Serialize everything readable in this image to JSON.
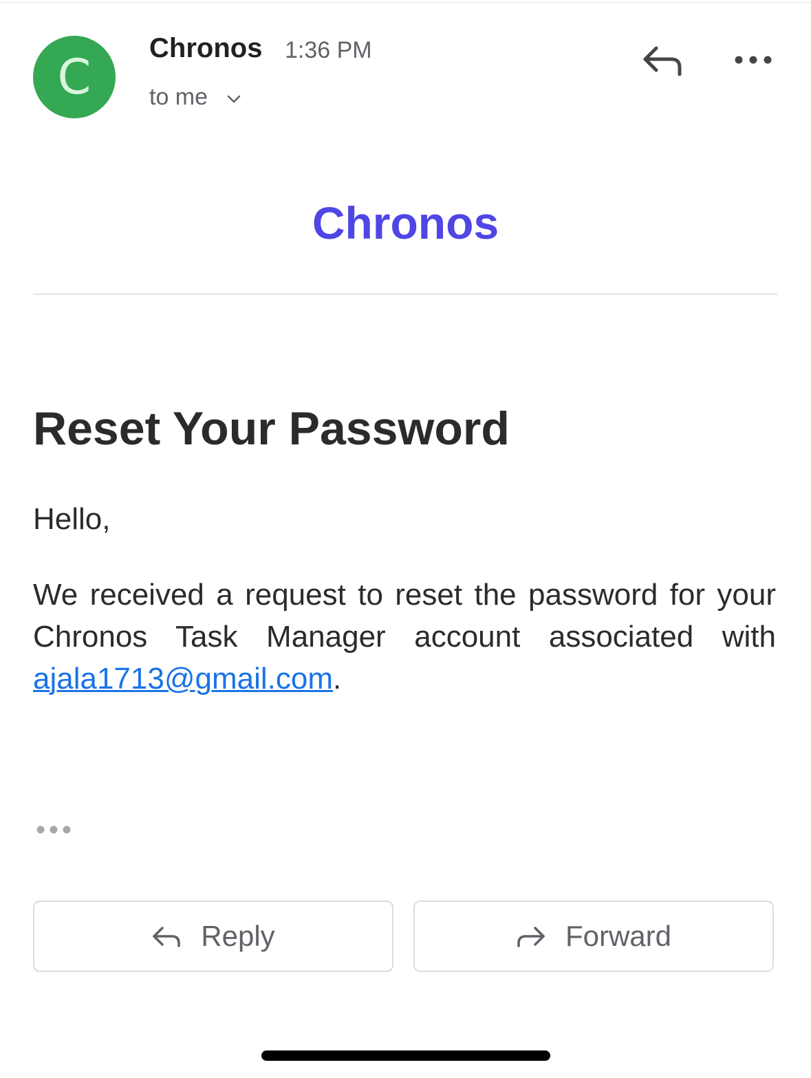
{
  "header": {
    "avatar_letter": "C",
    "sender": "Chronos",
    "time": "1:36 PM",
    "recipient": "to me",
    "avatar_color": "#34a853"
  },
  "email": {
    "brand": "Chronos",
    "brand_color": "#4f46e5",
    "heading": "Reset Your Password",
    "greeting": "Hello,",
    "body_before": "We received a request to reset the password for your Chronos Task Manager account associated with ",
    "email_link": "ajala1713@gmail.com",
    "body_after": "."
  },
  "actions": {
    "reply_label": "Reply",
    "forward_label": "Forward"
  },
  "icons": {
    "header_reply": "reply-icon",
    "more": "more-options-icon",
    "recipient_expand": "chevron-down-icon",
    "trimmed_content": "ellipsis-icon"
  }
}
